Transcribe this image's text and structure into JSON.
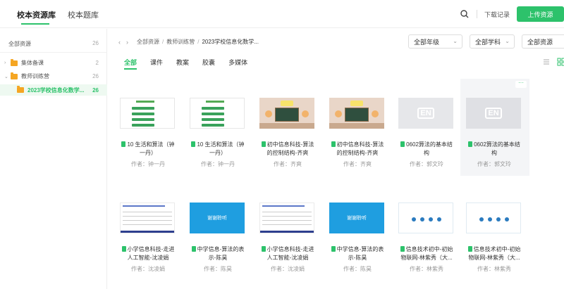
{
  "header": {
    "tabs": [
      "校本资源库",
      "校本题库"
    ],
    "download_label": "下载记录",
    "upload_label": "上传资源"
  },
  "sidebar": {
    "all": {
      "label": "全部资源",
      "count": "26"
    },
    "items": [
      {
        "label": "集体备课",
        "count": "2"
      },
      {
        "label": "教师训练营",
        "count": "26"
      },
      {
        "label": "2023学校信息化数学...",
        "count": "26"
      }
    ]
  },
  "breadcrumb": [
    "全部资源",
    "教师训练营",
    "2023学校信息化数学..."
  ],
  "filters": {
    "grade": "全部年级",
    "subject": "全部学科",
    "resource": "全部资源"
  },
  "type_tabs": [
    "全部",
    "课件",
    "教案",
    "胶囊",
    "多媒体"
  ],
  "cards": [
    {
      "title": "10 生活和算法（钟一丹）",
      "author": "作者：钟一丹",
      "thumb": "green"
    },
    {
      "title": "10 生活和算法（钟一丹）",
      "author": "作者：钟一丹",
      "thumb": "green"
    },
    {
      "title": "初中信息科技-算法的控制结构-齐爽",
      "author": "作者：齐爽",
      "thumb": "classroom"
    },
    {
      "title": "初中信息科技-算法的控制结构-齐爽",
      "author": "作者：齐爽",
      "thumb": "classroom"
    },
    {
      "title": "0602算法的基本结构",
      "author": "作者：郭文玲",
      "thumb": "gray"
    },
    {
      "title": "0602算法的基本结构",
      "author": "作者：郭文玲",
      "thumb": "gray"
    },
    {
      "title": "小学信息科技-走进人工智能-沈凌娟",
      "author": "作者：沈凌娟",
      "thumb": "table"
    },
    {
      "title": "中学信息-算法的表示-陈昊",
      "author": "作者：陈昊",
      "thumb": "blue",
      "thumb_text": "谢谢聆听"
    },
    {
      "title": "小学信息科技-走进人工智能-沈凌娟",
      "author": "作者：沈凌娟",
      "thumb": "table"
    },
    {
      "title": "中学信息-算法的表示-陈昊",
      "author": "作者：陈昊",
      "thumb": "blue",
      "thumb_text": "谢谢聆听"
    },
    {
      "title": "信息技术初中-初始物联网-林紫秀（大...",
      "author": "作者：林紫秀",
      "thumb": "dots"
    },
    {
      "title": "信息技术初中-初始物联网-林紫秀（大...",
      "author": "作者：林紫秀",
      "thumb": "dots"
    }
  ],
  "colors": {
    "accent": "#2dc26b",
    "folder": "#f5a623"
  },
  "icons": [
    "search-icon",
    "folder-icon",
    "chevron-left-icon",
    "chevron-right-icon",
    "list-view-icon",
    "grid-view-icon",
    "file-icon",
    "more-icon"
  ]
}
